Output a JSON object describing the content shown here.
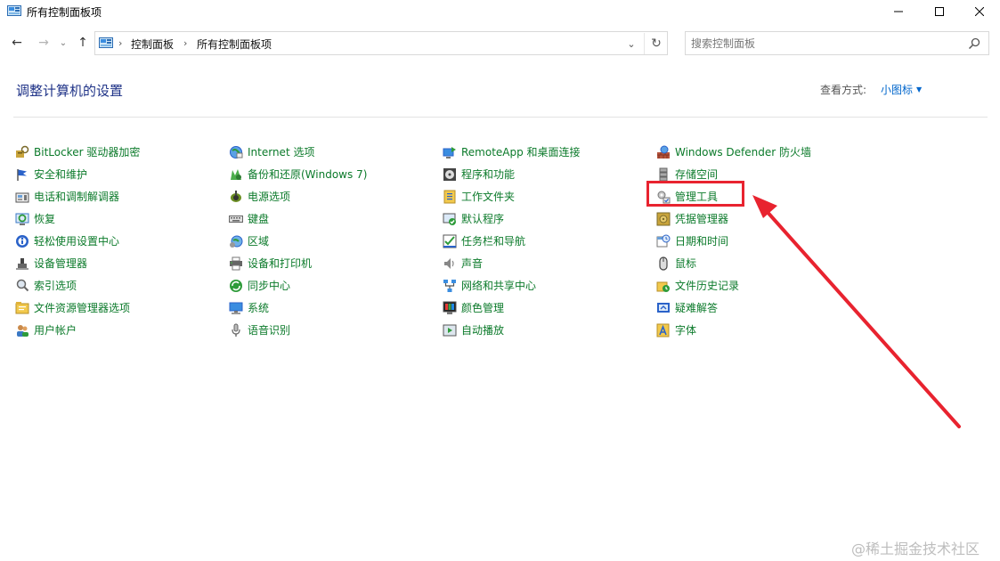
{
  "window": {
    "title": "所有控制面板项",
    "minimize_icon": "minimize-icon",
    "maximize_icon": "maximize-icon",
    "close_icon": "close-icon"
  },
  "nav": {
    "breadcrumbs": [
      "控制面板",
      "所有控制面板项"
    ],
    "breadcrumb_separator": "›",
    "back_icon": "arrow-left-icon",
    "forward_icon": "arrow-right-icon",
    "recent_icon": "chevron-down-icon",
    "up_icon": "arrow-up-icon",
    "dropdown_icon": "chevron-down-icon",
    "refresh_icon": "refresh-icon",
    "search_placeholder": "搜索控制面板"
  },
  "header": {
    "title": "调整计算机的设置",
    "view_label": "查看方式:",
    "view_value": "小图标"
  },
  "columns": [
    [
      {
        "label": "BitLocker 驱动器加密",
        "icon": "bitlocker-key-icon"
      },
      {
        "label": "安全和维护",
        "icon": "flag-icon"
      },
      {
        "label": "电话和调制解调器",
        "icon": "fax-modem-icon"
      },
      {
        "label": "恢复",
        "icon": "recovery-icon"
      },
      {
        "label": "轻松使用设置中心",
        "icon": "ease-of-access-icon"
      },
      {
        "label": "设备管理器",
        "icon": "device-manager-icon"
      },
      {
        "label": "索引选项",
        "icon": "indexing-magnifier-icon"
      },
      {
        "label": "文件资源管理器选项",
        "icon": "folder-options-icon"
      },
      {
        "label": "用户帐户",
        "icon": "user-accounts-icon"
      }
    ],
    [
      {
        "label": "Internet 选项",
        "icon": "internet-globe-icon"
      },
      {
        "label": "备份和还原(Windows 7)",
        "icon": "backup-restore-icon"
      },
      {
        "label": "电源选项",
        "icon": "power-options-icon"
      },
      {
        "label": "键盘",
        "icon": "keyboard-icon"
      },
      {
        "label": "区域",
        "icon": "region-globe-icon"
      },
      {
        "label": "设备和打印机",
        "icon": "printer-icon"
      },
      {
        "label": "同步中心",
        "icon": "sync-icon"
      },
      {
        "label": "系统",
        "icon": "system-monitor-icon"
      },
      {
        "label": "语音识别",
        "icon": "microphone-icon"
      }
    ],
    [
      {
        "label": "RemoteApp 和桌面连接",
        "icon": "remoteapp-icon"
      },
      {
        "label": "程序和功能",
        "icon": "programs-disc-icon"
      },
      {
        "label": "工作文件夹",
        "icon": "work-folders-icon"
      },
      {
        "label": "默认程序",
        "icon": "default-programs-icon"
      },
      {
        "label": "任务栏和导航",
        "icon": "taskbar-icon"
      },
      {
        "label": "声音",
        "icon": "speaker-icon"
      },
      {
        "label": "网络和共享中心",
        "icon": "network-icon"
      },
      {
        "label": "颜色管理",
        "icon": "color-management-icon"
      },
      {
        "label": "自动播放",
        "icon": "autoplay-icon"
      }
    ],
    [
      {
        "label": "Windows Defender 防火墙",
        "icon": "firewall-icon"
      },
      {
        "label": "存储空间",
        "icon": "storage-spaces-icon"
      },
      {
        "label": "管理工具",
        "icon": "admin-tools-icon"
      },
      {
        "label": "凭据管理器",
        "icon": "credential-vault-icon"
      },
      {
        "label": "日期和时间",
        "icon": "calendar-clock-icon"
      },
      {
        "label": "鼠标",
        "icon": "mouse-icon"
      },
      {
        "label": "文件历史记录",
        "icon": "file-history-icon"
      },
      {
        "label": "疑难解答",
        "icon": "troubleshooting-icon"
      },
      {
        "label": "字体",
        "icon": "fonts-icon"
      }
    ]
  ],
  "annotation": {
    "highlighted_item": "管理工具",
    "color": "#e8232f"
  },
  "watermark": "@稀土掘金技术社区",
  "colors": {
    "link_green": "#0b7a2a",
    "heading_blue": "#1e3287",
    "accent_blue": "#0066cc"
  }
}
